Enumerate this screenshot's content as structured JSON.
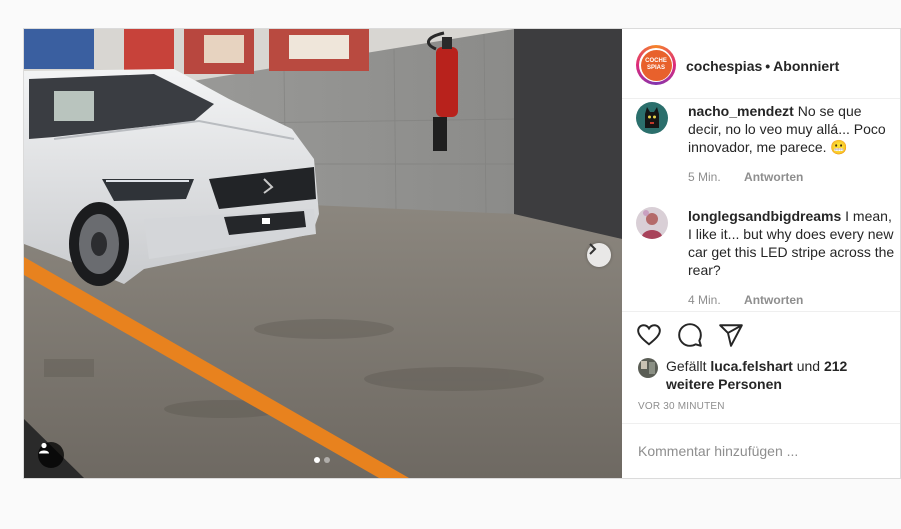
{
  "header": {
    "username": "cochespias",
    "separator": "•",
    "follow_state": "Abonniert",
    "avatar_logo_line1": "COCHE",
    "avatar_logo_line2": "SPIAS"
  },
  "comments": [
    {
      "username": "nacho_mendezt",
      "text": "No se que decir, no lo veo muy allá... Poco innovador, me parece. 😬",
      "time": "5 Min.",
      "reply_label": "Antworten"
    },
    {
      "username": "longlegsandbigdreams",
      "text": "I mean, I like it... but why does every new car get this LED stripe across the rear?",
      "time": "4 Min.",
      "reply_label": "Antworten"
    }
  ],
  "likes": {
    "prefix": "Gefällt",
    "user": "luca.felshart",
    "conjunction": "und",
    "others": "212 weitere Personen"
  },
  "timestamp": "VOR 30 MINUTEN",
  "comment_input": {
    "placeholder": "Kommentar hinzufügen ..."
  },
  "carousel": {
    "slide_count": 2,
    "current_slide": 1
  },
  "colors": {
    "story_ring": "#dd2a7b",
    "brand_logo": "#e8612c",
    "parking_stripe": "#e8821e",
    "primary_text": "#262626",
    "secondary_text": "#8e8e8e"
  }
}
